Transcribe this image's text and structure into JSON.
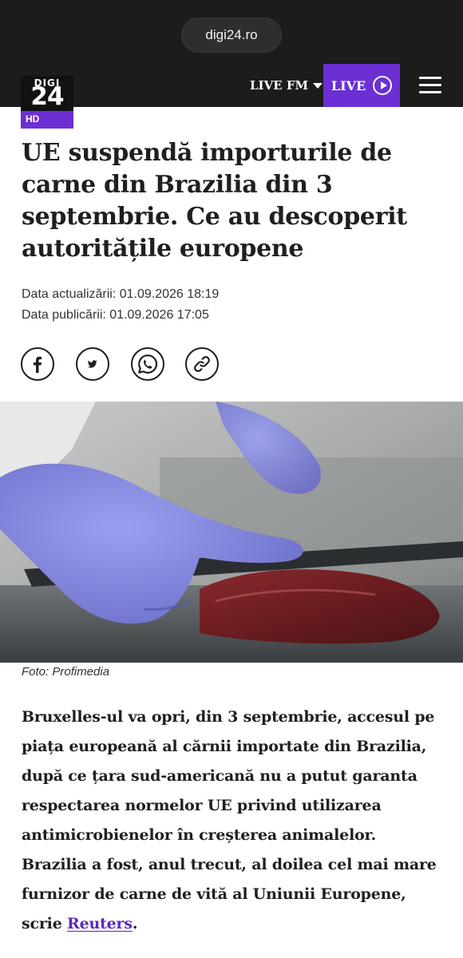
{
  "browser": {
    "url": "digi24.ro"
  },
  "header": {
    "logo": {
      "line1": "DIGI",
      "line2": "24",
      "badge": "HD"
    },
    "live_fm_label": "LIVE FM",
    "live_label": "LIVE"
  },
  "article": {
    "title": "UE suspendă importurile de carne din Brazilia din 3 septembrie. Ce au descoperit autoritățile europene",
    "updated": "Data actualizării: 01.09.2026 18:19",
    "published": "Data publicării: 01.09.2026 17:05",
    "share_icons": [
      "facebook-icon",
      "twitter-icon",
      "whatsapp-icon",
      "link-icon"
    ],
    "photo_caption": "Foto: Profimedia",
    "lead_text": "Bruxelles-ul va opri, din 3 septembrie, accesul pe piața europeană al cărnii importate din Brazilia, după ce țara sud-americană nu a putut garanta respectarea normelor UE privind utilizarea antimicrobienelor în creșterea animalelor. Brazilia a fost, anul trecut, al doilea cel mai mare furnizor de carne de vită al Uniunii Europene, scrie ",
    "lead_link": "Reuters",
    "lead_end": "."
  },
  "colors": {
    "brand_purple": "#6b2fd3",
    "header_bg": "#1c1c1c",
    "link": "#5b2ab8"
  }
}
